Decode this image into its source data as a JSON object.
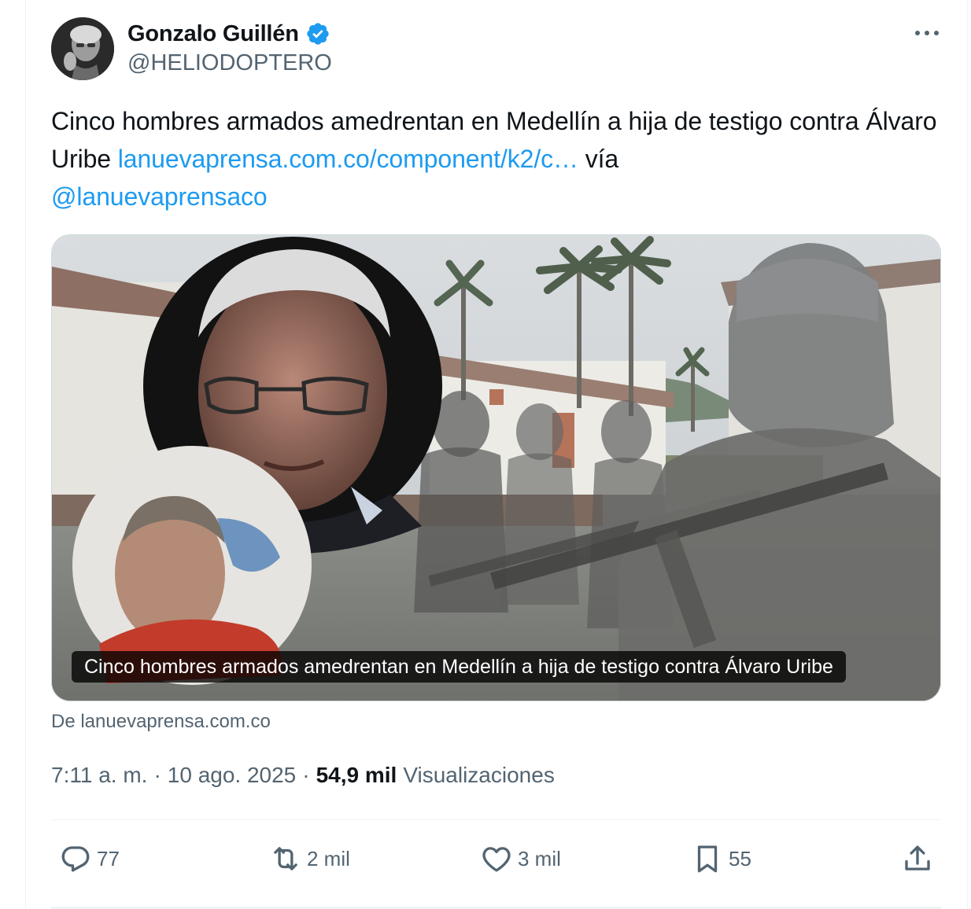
{
  "author": {
    "name": "Gonzalo Guillén",
    "handle": "@HELIODOPTERO",
    "verified": true,
    "avatar_icon": "author-avatar"
  },
  "tweet": {
    "text_main": "Cinco hombres armados amedrentan en Medellín a hija de testigo contra Álvaro Uribe ",
    "link_text": "lanuevaprensa.com.co/component/k2/c…",
    "via_text": " vía ",
    "mention": "@lanuevaprensaco"
  },
  "media_card": {
    "caption": "Cinco hombres armados amedrentan en Medellín a hija de testigo contra Álvaro Uribe",
    "source": "De lanuevaprensa.com.co"
  },
  "meta": {
    "time": "7:11 a. m.",
    "separator": "·",
    "date": "10 ago. 2025",
    "views_count": "54,9 mil",
    "views_label": "Visualizaciones"
  },
  "actions": {
    "replies": "77",
    "reposts": "2 mil",
    "likes": "3 mil",
    "bookmarks": "55"
  },
  "colors": {
    "accent": "#1d9bf0",
    "secondary_text": "#536471",
    "primary_text": "#0f1419",
    "verified_badge": "#1d9bf0"
  },
  "icons": {
    "more": "more-icon",
    "reply": "reply-icon",
    "repost": "repost-icon",
    "like": "heart-icon",
    "bookmark": "bookmark-icon",
    "share": "share-icon",
    "verified": "verified-badge-icon"
  }
}
